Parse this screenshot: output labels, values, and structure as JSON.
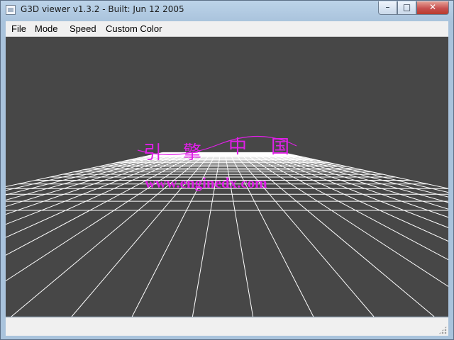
{
  "window": {
    "title": "G3D viewer v1.3.2 - Built: Jun 12 2005",
    "controls": {
      "minimize": "minimize-icon",
      "maximize": "maximize-icon",
      "close": "close-icon"
    }
  },
  "menu": {
    "items": [
      {
        "label": "File"
      },
      {
        "label": "Mode"
      },
      {
        "label": "Speed"
      },
      {
        "label": "Custom Color"
      }
    ]
  },
  "viewport": {
    "background_color": "#474747",
    "grid_color": "#ffffff",
    "watermark": {
      "chars": [
        "引",
        "擎",
        "中",
        "国"
      ],
      "url": "www.enginedx.com",
      "color": "#e020e8"
    }
  },
  "statusbar": {
    "text": ""
  },
  "colors": {
    "accent_close": "#c75050",
    "menu_bg": "#f0f0f0"
  }
}
